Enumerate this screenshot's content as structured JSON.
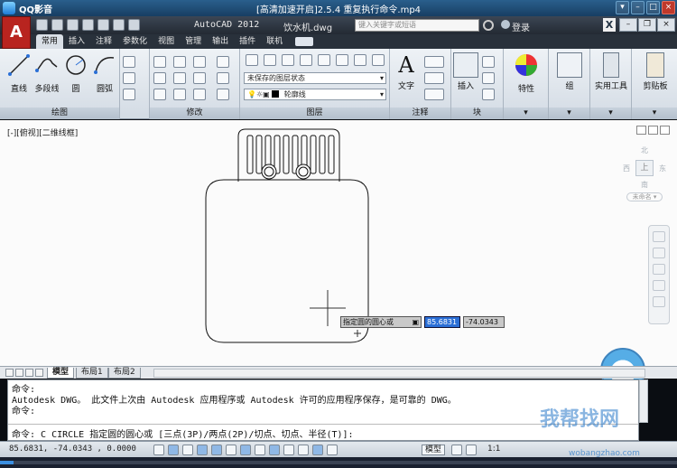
{
  "player": {
    "name": "QQ影音",
    "title": "[高清加速开启]2.5.4 重复执行命令.mp4",
    "progress": 0.02
  },
  "acad": {
    "app_name": "AutoCAD 2012",
    "file": "饮水机.dwg",
    "search_placeholder": "键入关键字或短语",
    "login": "登录",
    "x_label": "X"
  },
  "tabs": [
    "常用",
    "插入",
    "注释",
    "参数化",
    "视图",
    "管理",
    "输出",
    "插件",
    "联机"
  ],
  "ribbon": {
    "draw": {
      "title": "绘图",
      "line": "直线",
      "polyline": "多段线",
      "circle": "圆",
      "arc": "圆弧"
    },
    "modify": {
      "title": "修改"
    },
    "layers": {
      "title": "图层",
      "state": "未保存的图层状态",
      "current_layer": "轮廓线"
    },
    "annotation": {
      "title": "注释",
      "text": "文字"
    },
    "block": {
      "title": "块",
      "insert": "插入"
    },
    "properties": {
      "label": "特性"
    },
    "group": {
      "label": "组"
    },
    "utilities": {
      "label": "实用工具"
    },
    "clipboard": {
      "label": "剪贴板"
    }
  },
  "canvas": {
    "view_label": "[-][俯视][二维线框]",
    "cube_top": "上",
    "cube_north": "北",
    "cube_south": "南",
    "cube_west": "西",
    "cube_east": "东",
    "wcs": "未命名 ▾",
    "dyn_prompt": "指定圆的圆心或",
    "dyn_x": "85.6831",
    "dyn_y": "-74.0343"
  },
  "layout_tabs": [
    "模型",
    "布局1",
    "布局2"
  ],
  "command": {
    "line1": "命令:",
    "line2": "Autodesk DWG。  此文件上次由 Autodesk 应用程序或 Autodesk 许可的应用程序保存，是可靠的 DWG。",
    "line3": "命令:",
    "line4": "命令: C CIRCLE 指定圆的圆心或 [三点(3P)/两点(2P)/切点、切点、半径(T)]:"
  },
  "status": {
    "coords": "85.6831, -74.0343 , 0.0000",
    "model": "模型",
    "scale": "1:1"
  },
  "watermark": {
    "text": "我帮找网",
    "url": "wobangzhao.com"
  }
}
